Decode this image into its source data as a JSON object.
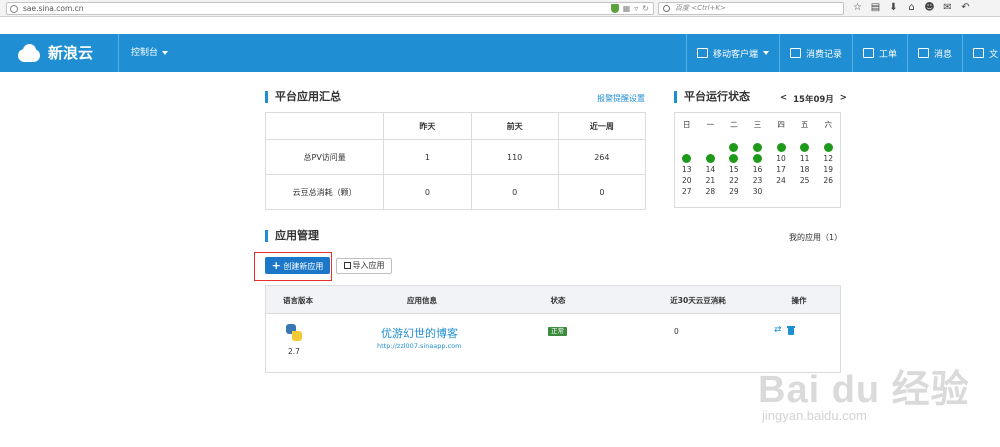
{
  "browser": {
    "url": "sae.sina.com.cn",
    "search_placeholder": "百度 <Ctrl+K>"
  },
  "header": {
    "logo_text": "新浪云",
    "console_label": "控制台",
    "nav": [
      {
        "label": "移动客户端",
        "icon": "phone-icon"
      },
      {
        "label": "消费记录",
        "icon": "receipt-icon"
      },
      {
        "label": "工单",
        "icon": "ticket-icon"
      },
      {
        "label": "消息",
        "icon": "message-icon"
      },
      {
        "label": "文",
        "icon": "doc-icon"
      }
    ]
  },
  "summary": {
    "title": "平台应用汇总",
    "alert_link": "报警提醒设置",
    "columns": [
      "",
      "昨天",
      "前天",
      "近一周"
    ],
    "rows": [
      {
        "label": "总PV访问量",
        "values": [
          "1",
          "110",
          "264"
        ]
      },
      {
        "label": "云豆总消耗（颗）",
        "values": [
          "0",
          "0",
          "0"
        ]
      }
    ]
  },
  "status": {
    "title": "平台运行状态",
    "prev": "<",
    "month": "15年09月",
    "next": ">",
    "weekdays": [
      "日",
      "一",
      "二",
      "三",
      "四",
      "五",
      "六"
    ],
    "days": [
      {
        "d": "",
        "dot": false
      },
      {
        "d": "",
        "dot": false
      },
      {
        "d": "",
        "dot": true
      },
      {
        "d": "",
        "dot": true
      },
      {
        "d": "",
        "dot": true
      },
      {
        "d": "",
        "dot": true
      },
      {
        "d": "",
        "dot": true
      },
      {
        "d": "",
        "dot": true
      },
      {
        "d": "",
        "dot": true
      },
      {
        "d": "",
        "dot": true
      },
      {
        "d": "",
        "dot": true
      },
      {
        "d": "10",
        "dot": false
      },
      {
        "d": "11",
        "dot": false
      },
      {
        "d": "12",
        "dot": false
      },
      {
        "d": "13",
        "dot": false
      },
      {
        "d": "14",
        "dot": false
      },
      {
        "d": "15",
        "dot": false
      },
      {
        "d": "16",
        "dot": false
      },
      {
        "d": "17",
        "dot": false
      },
      {
        "d": "18",
        "dot": false
      },
      {
        "d": "19",
        "dot": false
      },
      {
        "d": "20",
        "dot": false
      },
      {
        "d": "21",
        "dot": false
      },
      {
        "d": "22",
        "dot": false
      },
      {
        "d": "23",
        "dot": false
      },
      {
        "d": "24",
        "dot": false
      },
      {
        "d": "25",
        "dot": false
      },
      {
        "d": "26",
        "dot": false
      },
      {
        "d": "27",
        "dot": false
      },
      {
        "d": "28",
        "dot": false
      },
      {
        "d": "29",
        "dot": false
      },
      {
        "d": "30",
        "dot": false
      },
      {
        "d": "",
        "dot": false
      },
      {
        "d": "",
        "dot": false
      },
      {
        "d": "",
        "dot": false
      }
    ],
    "dot_color": "#1e9a1a"
  },
  "apps": {
    "title": "应用管理",
    "my_apps": "我的应用（1）",
    "create_label": "创建新应用",
    "import_label": "导入应用",
    "columns": [
      "语言版本",
      "应用信息",
      "状态",
      "近30天云豆消耗",
      "操作"
    ],
    "items": [
      {
        "lang_version": "2.7",
        "name": "优游幻世的博客",
        "url": "http://zzl007.sinaapp.com",
        "status": "正常",
        "usage": "0"
      }
    ]
  },
  "watermark": {
    "main": "Bai du 经验",
    "sub": "jingyan.baidu.com"
  },
  "colors": {
    "brand": "#1f8ed3",
    "button": "#1c77c8",
    "highlight": "#e63030",
    "status_ok": "#3c8b3c"
  }
}
